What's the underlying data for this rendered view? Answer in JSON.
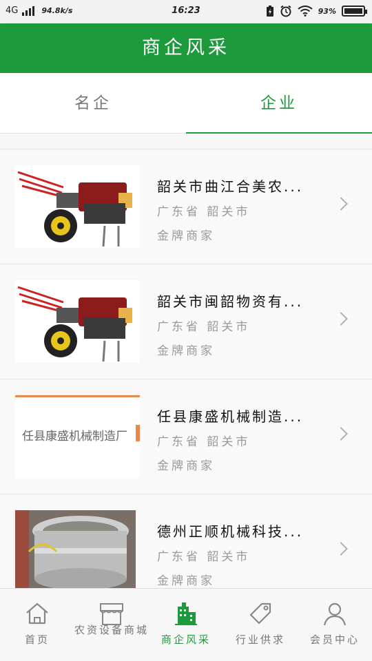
{
  "status_bar": {
    "network": "4G",
    "speed": "94.8k/s",
    "time": "16:23",
    "battery_text": "93%"
  },
  "header": {
    "title": "商企风采"
  },
  "tabs": [
    {
      "label": "名企",
      "active": false
    },
    {
      "label": "企业",
      "active": true
    }
  ],
  "companies": [
    {
      "name": "韶关市曲江合美农...",
      "location": "广东省 韶关市",
      "level": "金牌商家",
      "image": "tractor"
    },
    {
      "name": "韶关市闽韶物资有...",
      "location": "广东省 韶关市",
      "level": "金牌商家",
      "image": "tractor"
    },
    {
      "name": " 任县康盛机械制造...",
      "location": "广东省 韶关市",
      "level": "金牌商家",
      "image": "sign",
      "image_text": "任县康盛机械制造厂"
    },
    {
      "name": "德州正顺机械科技...",
      "location": "广东省 韶关市",
      "level": "金牌商家",
      "image": "machine"
    }
  ],
  "bottom_nav": [
    {
      "label": "首页",
      "icon": "home-icon",
      "active": false
    },
    {
      "label": "农资设备商城",
      "icon": "store-icon",
      "active": false
    },
    {
      "label": "商企风采",
      "icon": "building-icon",
      "active": true
    },
    {
      "label": "行业供求",
      "icon": "tag-icon",
      "active": false
    },
    {
      "label": "会员中心",
      "icon": "user-icon",
      "active": false
    }
  ],
  "colors": {
    "brand": "#1d9a3c",
    "inactive": "#777777"
  }
}
